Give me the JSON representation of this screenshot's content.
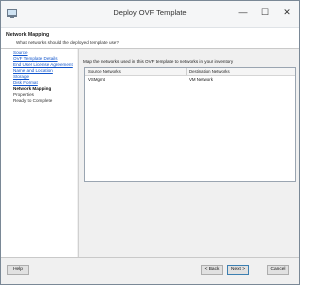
{
  "window": {
    "title": "Deploy OVF Template",
    "controls": {
      "minimize": "—",
      "maximize": "☐",
      "close": "✕"
    }
  },
  "header": {
    "title": "Network Mapping",
    "subtitle": "What networks should the deployed template use?"
  },
  "sidebar": {
    "items": [
      {
        "label": "Source",
        "state": "completed"
      },
      {
        "label": "OVF Template Details",
        "state": "completed"
      },
      {
        "label": "End User License Agreement",
        "state": "completed"
      },
      {
        "label": "Name and Location",
        "state": "completed"
      },
      {
        "label": "Storage",
        "state": "completed"
      },
      {
        "label": "Disk Format",
        "state": "completed"
      },
      {
        "label": "Network Mapping",
        "state": "current"
      },
      {
        "label": "Properties",
        "state": "pending"
      },
      {
        "label": "Ready to Complete",
        "state": "pending"
      }
    ]
  },
  "main": {
    "instruction": "Map the networks used in this OVF template to networks in your inventory",
    "table": {
      "columns": [
        "Source Networks",
        "Destination Networks"
      ],
      "rows": [
        [
          "VSMgmt",
          "VM Network"
        ]
      ]
    }
  },
  "buttons": {
    "help": "Help",
    "back": "< Back",
    "next": "Next >",
    "cancel": "Cancel"
  },
  "colors": {
    "link": "#1155cc",
    "accent": "#3c7fb1"
  }
}
